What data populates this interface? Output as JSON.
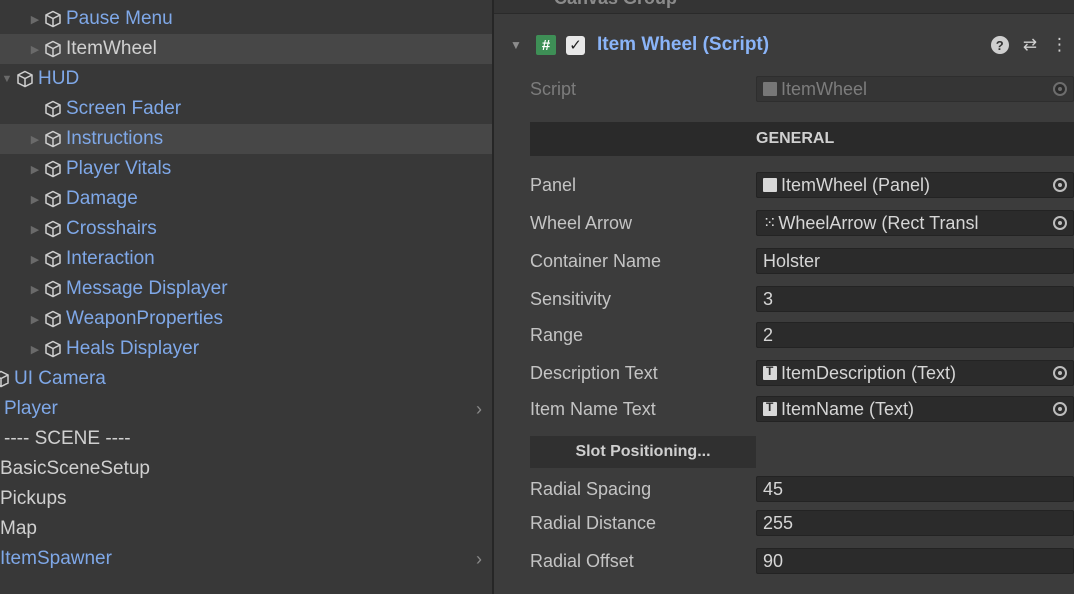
{
  "hierarchy": {
    "items": [
      {
        "label": "Pause Menu",
        "fold": "▶",
        "kind": "prefab"
      },
      {
        "label": "ItemWheel",
        "fold": "▶",
        "kind": "prefab",
        "selected": true
      },
      {
        "label": "HUD",
        "fold": "▼",
        "kind": "prefab"
      },
      {
        "label": "Screen Fader",
        "fold": "",
        "kind": "prefab"
      },
      {
        "label": "Instructions",
        "fold": "▶",
        "kind": "prefab",
        "selected": true
      },
      {
        "label": "Player Vitals",
        "fold": "▶",
        "kind": "prefab"
      },
      {
        "label": "Damage",
        "fold": "▶",
        "kind": "prefab"
      },
      {
        "label": "Crosshairs",
        "fold": "▶",
        "kind": "prefab"
      },
      {
        "label": "Interaction",
        "fold": "▶",
        "kind": "prefab"
      },
      {
        "label": "Message Displayer",
        "fold": "▶",
        "kind": "prefab"
      },
      {
        "label": "WeaponProperties",
        "fold": "▶",
        "kind": "prefab"
      },
      {
        "label": "Heals Displayer",
        "fold": "▶",
        "kind": "prefab"
      },
      {
        "label": "UI Camera",
        "kind": "prefab"
      },
      {
        "label": "Player",
        "kind": "prefab",
        "chevron": "›"
      },
      {
        "label": "---- SCENE ----",
        "kind": "plain"
      },
      {
        "label": "BasicSceneSetup",
        "kind": "plain"
      },
      {
        "label": "Pickups",
        "kind": "plain"
      },
      {
        "label": "Map",
        "kind": "plain"
      },
      {
        "label": "ItemSpawner",
        "kind": "prefab",
        "chevron": "›"
      }
    ]
  },
  "inspector": {
    "prev_component": "Canvas Group",
    "component": {
      "title": "Item Wheel (Script)",
      "enabled_mark": "✓",
      "script_icon": "#",
      "help": "?",
      "settings": "⇄",
      "menu": "⋮"
    },
    "script": {
      "label": "Script",
      "value": "ItemWheel"
    },
    "general_header": "GENERAL",
    "fields": [
      {
        "label": "Panel",
        "value": "ItemWheel (Panel)",
        "icon": "object-icon"
      },
      {
        "label": "Wheel Arrow",
        "value": "WheelArrow (Rect Transl",
        "icon": "rect-transform-icon"
      },
      {
        "label": "Container Name",
        "value": "Holster"
      },
      {
        "label": "Sensitivity",
        "value": "3"
      },
      {
        "label": "Range",
        "value": "2"
      },
      {
        "label": "Description Text",
        "value": "ItemDescription (Text)",
        "icon": "text-icon"
      },
      {
        "label": "Item Name Text",
        "value": "ItemName (Text)",
        "icon": "text-icon"
      }
    ],
    "slot_button": "Slot Positioning...",
    "slot_fields": [
      {
        "label": "Radial Spacing",
        "value": "45"
      },
      {
        "label": "Radial Distance",
        "value": "255"
      },
      {
        "label": "Radial Offset",
        "value": "90"
      }
    ]
  },
  "colors": {
    "prefab_text": "#7fa8e8",
    "component_title": "#8ab4f8",
    "script_icon_bg": "#3e8f56",
    "panel_bg": "#383838",
    "field_bg": "#2b2b2b"
  }
}
